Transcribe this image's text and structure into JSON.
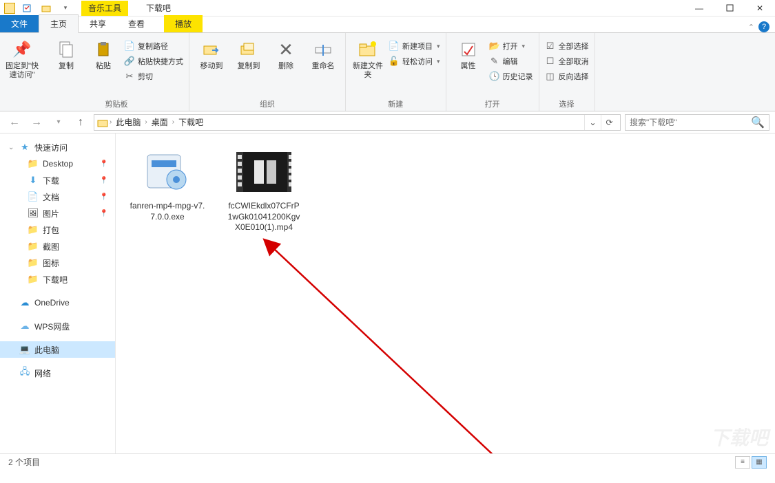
{
  "title": {
    "tools_label": "音乐工具",
    "window_title": "下载吧"
  },
  "tabs": {
    "file": "文件",
    "home": "主页",
    "share": "共享",
    "view": "查看",
    "play": "播放"
  },
  "ribbon": {
    "pin": {
      "label": "固定到\"快速访问\""
    },
    "copy": {
      "label": "复制"
    },
    "paste": {
      "label": "粘贴"
    },
    "copy_path": "复制路径",
    "paste_shortcut": "粘贴快捷方式",
    "cut": "剪切",
    "group_clipboard": "剪贴板",
    "move_to": "移动到",
    "copy_to": "复制到",
    "delete": "删除",
    "rename": "重命名",
    "group_organize": "组织",
    "new_folder": "新建文件夹",
    "new_item": "新建项目",
    "easy_access": "轻松访问",
    "group_new": "新建",
    "properties": "属性",
    "open": "打开",
    "edit": "编辑",
    "history": "历史记录",
    "group_open": "打开",
    "select_all": "全部选择",
    "select_none": "全部取消",
    "invert": "反向选择",
    "group_select": "选择"
  },
  "breadcrumb": {
    "seg1": "此电脑",
    "seg2": "桌面",
    "seg3": "下载吧"
  },
  "search": {
    "placeholder": "搜索\"下载吧\""
  },
  "nav": {
    "quick": "快速访问",
    "desktop": "Desktop",
    "downloads": "下载",
    "documents": "文档",
    "pictures": "图片",
    "dabao": "打包",
    "jietu": "截图",
    "tubiao": "图标",
    "xiazaiba": "下载吧",
    "onedrive": "OneDrive",
    "wps": "WPS网盘",
    "thispc": "此电脑",
    "network": "网络"
  },
  "files": [
    {
      "name": "fanren-mp4-mpg-v7.7.0.0.exe"
    },
    {
      "name": "fcCWIEkdlx07CFrP1wGk01041200KgvX0E010(1).mp4"
    }
  ],
  "status": {
    "count": "2 个项目"
  },
  "watermark": "下载吧"
}
